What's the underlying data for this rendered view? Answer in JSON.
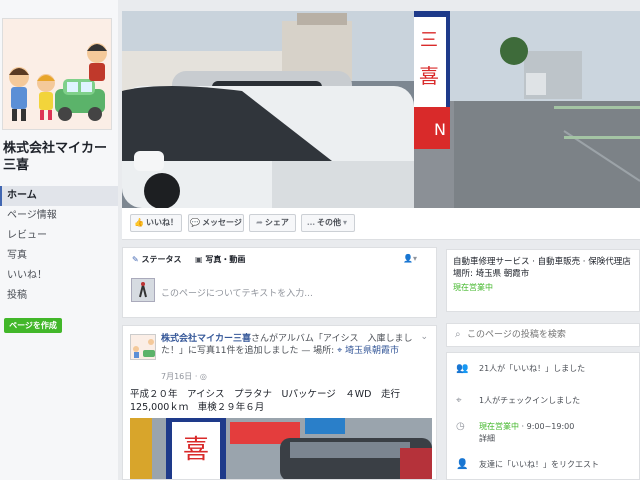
{
  "page": {
    "name": "株式会社マイカー三喜"
  },
  "nav": {
    "items": [
      "ホーム",
      "ページ情報",
      "レビュー",
      "写真",
      "いいね！",
      "投稿"
    ],
    "create_ad": "ページを作成"
  },
  "actions": {
    "like": "いいね！",
    "message": "メッセージ",
    "share": "シェア",
    "more": "その他"
  },
  "composer": {
    "status_tab": "ステータス",
    "photo_tab": "写真・動画",
    "placeholder": "このページについてテキストを入力..."
  },
  "post": {
    "author": "株式会社マイカー三喜",
    "action_text": "さんがアルバム「アイシス　入庫しました！」に写真11件を追加しました — 場所:",
    "location": "埼玉県朝霞市",
    "date": "7月16日",
    "body": "平成２０年　アイシス　プラタナ　Uパッケージ　４WD　走行125,000ｋｍ　車検２９年６月"
  },
  "about": {
    "categories": "自動車修理サービス · 自動車販売 · 保険代理店",
    "location": "場所: 埼玉県 朝霞市",
    "open_now": "現在営業中"
  },
  "search": {
    "placeholder": "このページの投稿を検索"
  },
  "stats": {
    "likes": "21人が「いいね！」しました",
    "checkins": "1人がチェックインしました",
    "hours_status": "現在営業中",
    "hours": "· 9:00~19:00",
    "hours_more": "詳細",
    "invite": "友達に「いいね！」をリクエスト"
  },
  "colors": {
    "accent": "#4267b2",
    "link": "#365899",
    "green": "#42b72a",
    "background": "#e9ebee"
  }
}
